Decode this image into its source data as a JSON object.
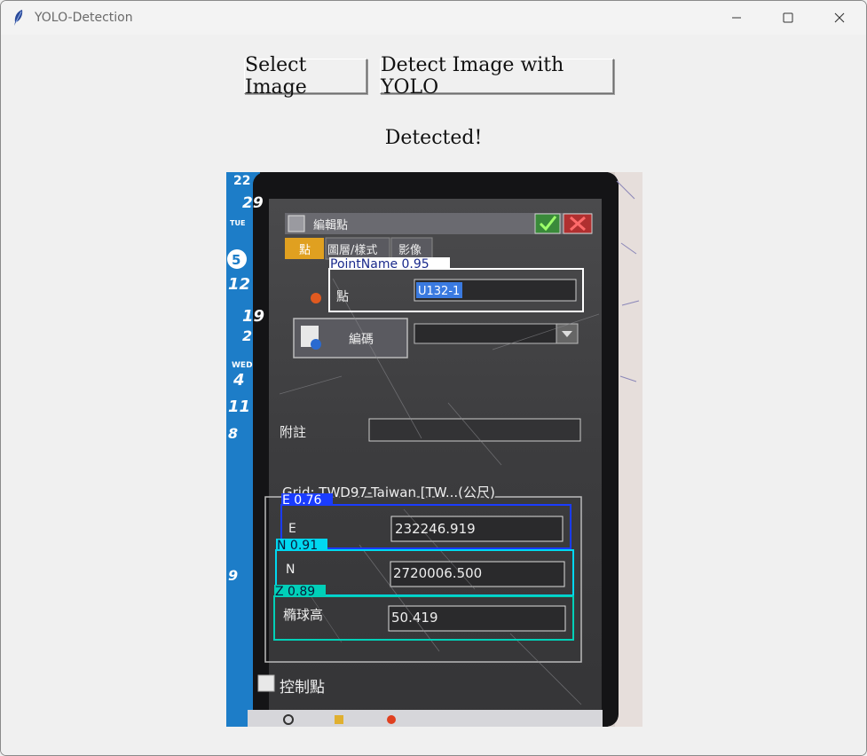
{
  "window": {
    "title": "YOLO-Detection",
    "icons": [
      "feather-icon",
      "minimize-icon",
      "maximize-icon",
      "close-icon"
    ]
  },
  "toolbar": {
    "select_label": "Select Image",
    "detect_label": "Detect Image with YOLO"
  },
  "status_text": "Detected!",
  "image": {
    "calendar": {
      "numbers": [
        "22",
        "29",
        "5",
        "12",
        "19",
        "2",
        "9",
        "4",
        "11",
        "8"
      ],
      "day_labels": [
        "TUE",
        "WED"
      ]
    },
    "phone_ui": {
      "dialog_title": "編輯點",
      "tabs": [
        "點",
        "圖層/樣式",
        "影像"
      ],
      "point_label": "點",
      "point_value": "U132-1",
      "code_button": "編碼",
      "note_label": "附註",
      "grid_title": "Grid: TWD97-Taiwan [TW...(公尺)",
      "e_label": "E",
      "e_value": "232246.919",
      "n_label": "N",
      "n_value": "2720006.500",
      "z_label": "橢球高",
      "z_value": "50.419",
      "control_label": "控制點"
    },
    "detections": [
      {
        "label": "PointName 0.95",
        "color": "#ffffff",
        "text_color": "#1a2a8c"
      },
      {
        "label": "E 0.76",
        "color": "#1a3cff",
        "text_color": "#ffffff"
      },
      {
        "label": "N 0.91",
        "color": "#00d8f0",
        "text_color": "#0a1a3a"
      },
      {
        "label": "Z 0.89",
        "color": "#00d0b8",
        "text_color": "#0a1a3a"
      }
    ]
  }
}
